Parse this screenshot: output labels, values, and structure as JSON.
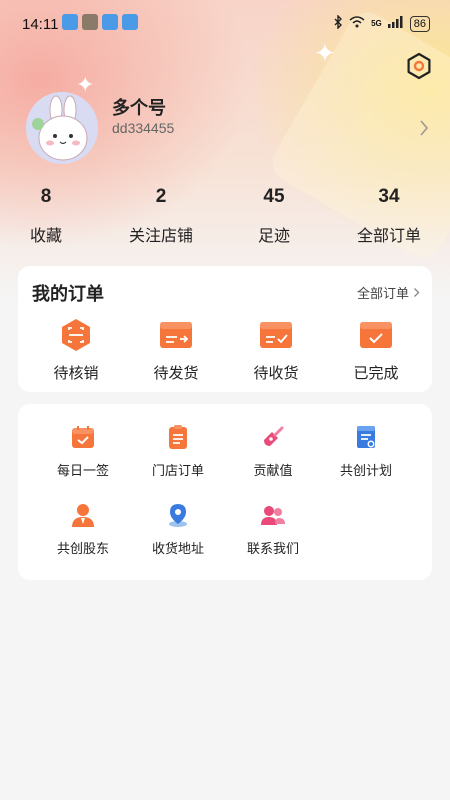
{
  "status_bar": {
    "time": "14:11",
    "network": "5G",
    "battery": "86"
  },
  "profile": {
    "name": "多个号",
    "id": "dd334455"
  },
  "stats": [
    {
      "value": "8",
      "label": "收藏"
    },
    {
      "value": "2",
      "label": "关注店铺"
    },
    {
      "value": "45",
      "label": "足迹"
    },
    {
      "value": "34",
      "label": "全部订单"
    }
  ],
  "orders": {
    "title": "我的订单",
    "all_link": "全部订单",
    "items": [
      {
        "label": "待核销",
        "icon": "scan-code-icon"
      },
      {
        "label": "待发货",
        "icon": "ship-box-icon"
      },
      {
        "label": "待收货",
        "icon": "receive-box-icon"
      },
      {
        "label": "已完成",
        "icon": "completed-box-icon"
      }
    ]
  },
  "tools": {
    "items": [
      {
        "label": "每日一签",
        "icon": "calendar-check-icon"
      },
      {
        "label": "门店订单",
        "icon": "clipboard-list-icon"
      },
      {
        "label": "贡献值",
        "icon": "shovel-icon"
      },
      {
        "label": "共创计划",
        "icon": "document-icon"
      },
      {
        "label": "共创股东",
        "icon": "person-tie-icon"
      },
      {
        "label": "收货地址",
        "icon": "location-pin-icon"
      },
      {
        "label": "联系我们",
        "icon": "users-icon"
      }
    ]
  },
  "colors": {
    "accent_orange": "#f5753b",
    "card_bg": "#ffffff",
    "page_bg": "#f5f5f5"
  }
}
